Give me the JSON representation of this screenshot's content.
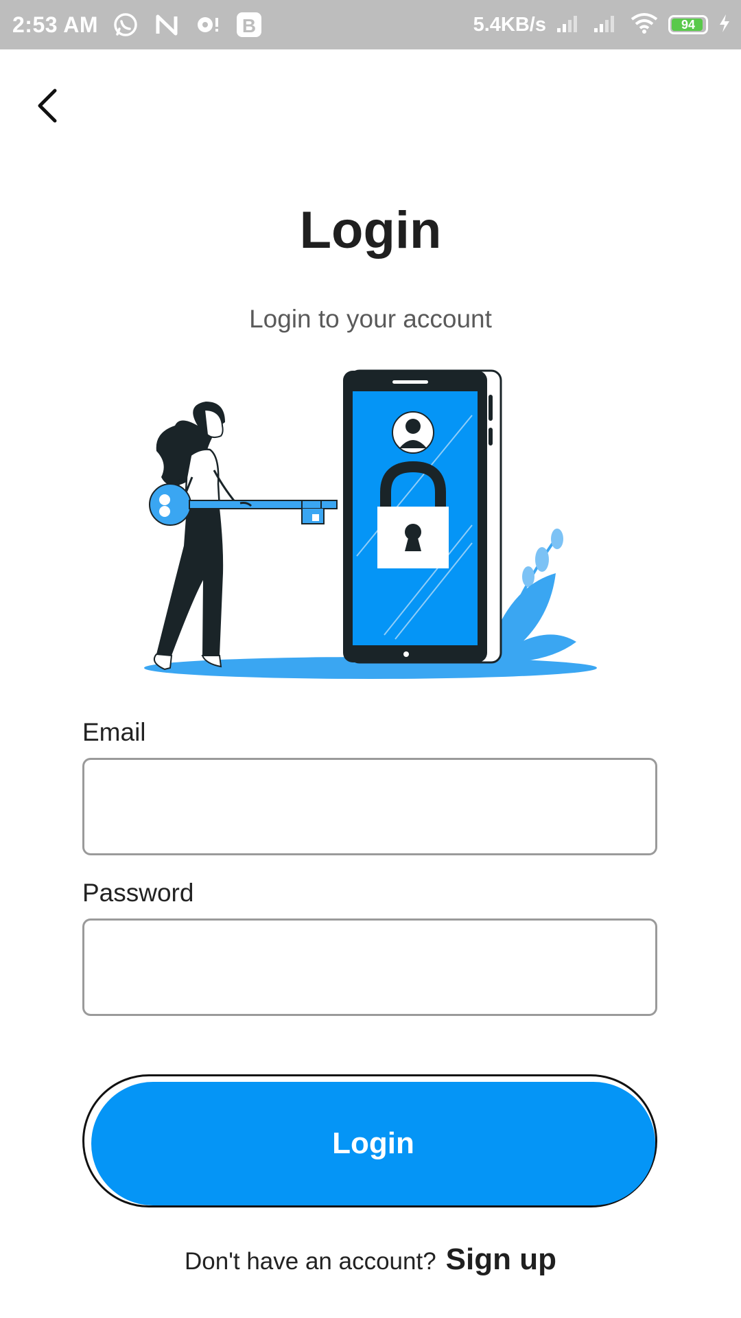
{
  "status_bar": {
    "time": "2:53 AM",
    "speed": "5.4KB/s",
    "battery": "94",
    "battery_level": 0.94,
    "icons": [
      "whatsapp-icon",
      "n-icon",
      "alert-icon",
      "b-icon",
      "signal-icon",
      "signal-icon-2",
      "wifi-icon",
      "battery-icon",
      "charging-icon"
    ]
  },
  "header": {
    "back_icon": "chevron-left-icon"
  },
  "page": {
    "title": "Login",
    "subtitle": "Login to your account"
  },
  "form": {
    "email_label": "Email",
    "email_value": "",
    "password_label": "Password",
    "password_value": "",
    "login_button": "Login"
  },
  "footer": {
    "question": "Don't have an account?",
    "signup_link": "Sign up"
  },
  "colors": {
    "primary": "#0595f6",
    "illustration_blue": "#3aa6f2",
    "dark": "#1a2428",
    "status_bar": "#bdbdbd",
    "battery_green": "#59c94a"
  }
}
